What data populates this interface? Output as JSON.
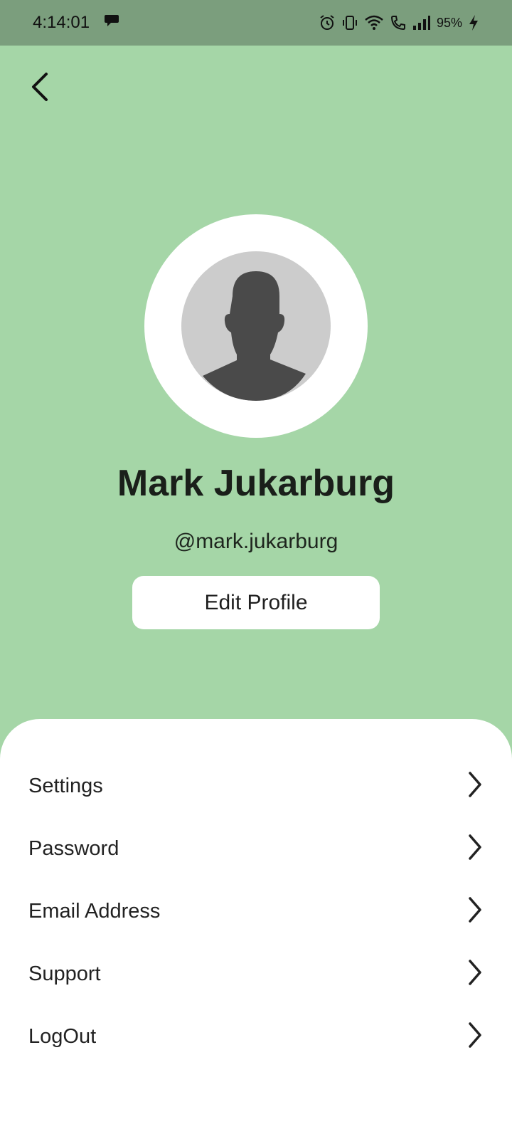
{
  "status_bar": {
    "time": "4:14:01",
    "battery": "95%",
    "icons": [
      "chat-bubble-icon",
      "alarm-icon",
      "vibrate-icon",
      "wifi-icon",
      "wifi-call-icon",
      "signal-icon",
      "charging-icon"
    ]
  },
  "header": {
    "back_icon": "back-arrow-icon",
    "avatar_icon": "default-person-silhouette",
    "name": "Mark Jukarburg",
    "handle": "@mark.jukarburg",
    "edit_label": "Edit Profile"
  },
  "menu": {
    "items": [
      {
        "label": "Settings"
      },
      {
        "label": "Password"
      },
      {
        "label": "Email Address"
      },
      {
        "label": "Support"
      },
      {
        "label": "LogOut"
      }
    ]
  },
  "colors": {
    "header_bg": "#a5d6a7",
    "status_bar_bg": "#7b9e7d",
    "sheet_bg": "#ffffff",
    "avatar_bg": "#cccccc",
    "silhouette": "#4a4a4a"
  }
}
